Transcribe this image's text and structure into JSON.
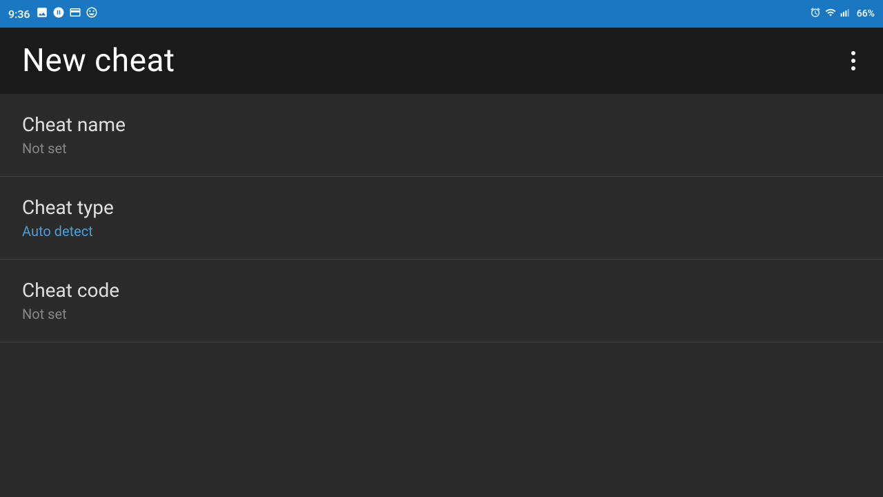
{
  "statusBar": {
    "time": "9:36",
    "battery": "66%",
    "icons": {
      "photo": "🖼",
      "sync": "☁",
      "nfc": "💳",
      "other": "😊"
    }
  },
  "appBar": {
    "title": "New cheat",
    "moreMenuLabel": "More options"
  },
  "listItems": [
    {
      "id": "cheat-name",
      "title": "Cheat name",
      "subtitle": "Not set",
      "subtitleStyle": "muted"
    },
    {
      "id": "cheat-type",
      "title": "Cheat type",
      "subtitle": "Auto detect",
      "subtitleStyle": "accent"
    },
    {
      "id": "cheat-code",
      "title": "Cheat code",
      "subtitle": "Not set",
      "subtitleStyle": "muted"
    }
  ]
}
